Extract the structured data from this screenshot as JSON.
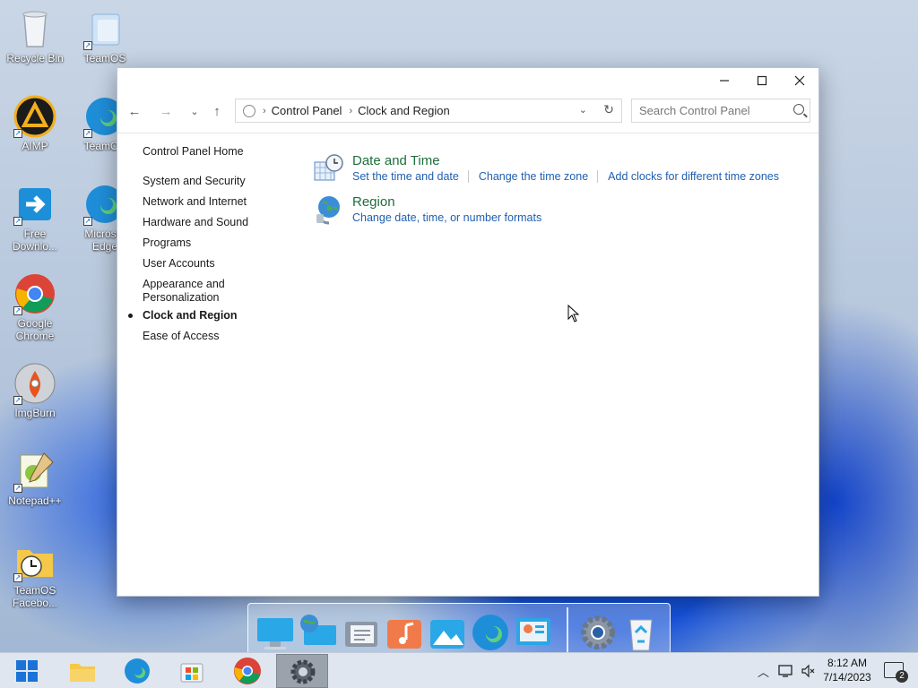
{
  "desktop": {
    "icons": [
      {
        "label": "Recycle Bin"
      },
      {
        "label": "TeamOS"
      },
      {
        "label": "AIMP"
      },
      {
        "label": "TeamOS"
      },
      {
        "label": "Free Downlo..."
      },
      {
        "label": "Microsof Edge"
      },
      {
        "label": "Google Chrome"
      },
      {
        "label": "ImgBurn"
      },
      {
        "label": "Notepad++"
      },
      {
        "label": "TeamOS Facebo..."
      }
    ]
  },
  "window": {
    "address": {
      "segments": [
        "Control Panel",
        "Clock and Region"
      ]
    },
    "search": {
      "placeholder": "Search Control Panel"
    },
    "leftnav": {
      "home": "Control Panel Home",
      "items": [
        "System and Security",
        "Network and Internet",
        "Hardware and Sound",
        "Programs",
        "User Accounts",
        "Appearance and",
        "Personalization",
        "Clock and Region",
        "Ease of Access"
      ]
    },
    "categories": [
      {
        "title": "Date and Time",
        "links": [
          "Set the time and date",
          "Change the time zone",
          "Add clocks for different time zones"
        ]
      },
      {
        "title": "Region",
        "links": [
          "Change date, time, or number formats"
        ]
      }
    ]
  },
  "taskbar": {
    "time": "8:12 AM",
    "date": "7/14/2023",
    "notifications": "2"
  },
  "colors": {
    "link": "#1f5fb0",
    "category_title": "#1e6e3c"
  }
}
